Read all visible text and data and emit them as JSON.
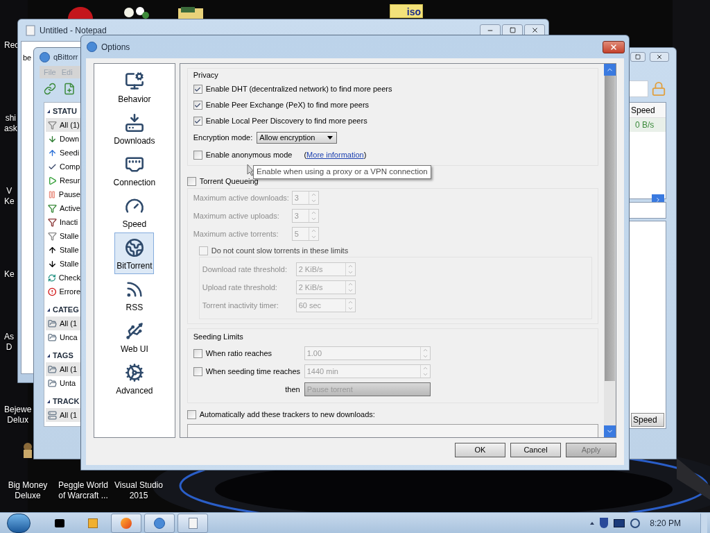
{
  "desktop": {
    "icons": [
      {
        "lines": [
          "Rec"
        ]
      },
      {
        "lines": [
          "shi",
          "ask"
        ]
      },
      {
        "lines": [
          "V",
          "Ke"
        ]
      },
      {
        "lines": [
          "Ke"
        ]
      },
      {
        "lines": [
          "As",
          "D"
        ]
      },
      {
        "lines": [
          "Bejewe",
          "Delux"
        ]
      }
    ],
    "bottom_icons": [
      {
        "lines": [
          "Big Money",
          "Deluxe"
        ]
      },
      {
        "lines": [
          "Peggle World",
          "of Warcraft ..."
        ]
      },
      {
        "lines": [
          "Visual Studio",
          "2015"
        ]
      }
    ],
    "file_icon_label": "iso"
  },
  "notepad": {
    "title": "Untitled - Notepad",
    "text": "be"
  },
  "qbittorrent": {
    "title": "qBittorr",
    "menu": [
      "File",
      "Edi"
    ],
    "sections": [
      {
        "title": "STATU",
        "items": [
          {
            "label": "All (1)",
            "selected": true
          },
          {
            "label": "Down",
            "selected": false
          },
          {
            "label": "Seedi",
            "selected": false
          },
          {
            "label": "Comp",
            "selected": false
          },
          {
            "label": "Resur",
            "selected": false
          },
          {
            "label": "Pause",
            "selected": false
          },
          {
            "label": "Active",
            "selected": false
          },
          {
            "label": "Inacti",
            "selected": false
          },
          {
            "label": "Stalle",
            "selected": false
          },
          {
            "label": "Stalle",
            "selected": false
          },
          {
            "label": "Stalle",
            "selected": false
          },
          {
            "label": "Check",
            "selected": false
          },
          {
            "label": "Errore",
            "selected": false
          }
        ]
      },
      {
        "title": "CATEG",
        "items": [
          {
            "label": "All (1",
            "selected": true
          },
          {
            "label": "Unca",
            "selected": false
          }
        ]
      },
      {
        "title": "TAGS",
        "items": [
          {
            "label": "All (1",
            "selected": true
          },
          {
            "label": "Unta",
            "selected": false
          }
        ]
      },
      {
        "title": "TRACK",
        "items": [
          {
            "label": "All (1",
            "selected": true
          }
        ]
      }
    ],
    "column_header": "Speed",
    "cell": "0 B/s",
    "speed_button": "Speed"
  },
  "options": {
    "title": "Options",
    "pages": [
      {
        "label": "Behavior",
        "selected": false
      },
      {
        "label": "Downloads",
        "selected": false
      },
      {
        "label": "Connection",
        "selected": false
      },
      {
        "label": "Speed",
        "selected": false
      },
      {
        "label": "BitTorrent",
        "selected": true
      },
      {
        "label": "RSS",
        "selected": false
      },
      {
        "label": "Web UI",
        "selected": false
      },
      {
        "label": "Advanced",
        "selected": false
      }
    ],
    "privacy": {
      "title": "Privacy",
      "checks": [
        {
          "label": "Enable DHT (decentralized network) to find more peers",
          "checked": true
        },
        {
          "label": "Enable Peer Exchange (PeX) to find more peers",
          "checked": true
        },
        {
          "label": "Enable Local Peer Discovery to find more peers",
          "checked": true
        }
      ],
      "encryption_label": "Encryption mode:",
      "encryption_value": "Allow encryption",
      "anonymous": {
        "label": "Enable anonymous mode",
        "checked": false
      },
      "link_open": "(",
      "link": "More information",
      "link_close": ")"
    },
    "tooltip": "Enable when using a proxy or a VPN connection",
    "queueing": {
      "label": "Torrent Queueing",
      "checked": false,
      "fields": [
        {
          "label": "Maximum active downloads:",
          "value": "3"
        },
        {
          "label": "Maximum active uploads:",
          "value": "3"
        },
        {
          "label": "Maximum active torrents:",
          "value": "5"
        }
      ],
      "slow": {
        "label": "Do not count slow torrents in these limits",
        "checked": false
      },
      "slow_fields": [
        {
          "label": "Download rate threshold:",
          "value": "2 KiB/s"
        },
        {
          "label": "Upload rate threshold:",
          "value": "2 KiB/s"
        },
        {
          "label": "Torrent inactivity timer:",
          "value": "60 sec"
        }
      ]
    },
    "seeding": {
      "title": "Seeding Limits",
      "limits": [
        {
          "label": "When ratio reaches",
          "checked": false,
          "value": "1.00"
        },
        {
          "label": "When seeding time reaches",
          "checked": false,
          "value": "1440 min"
        }
      ],
      "then_label": "then",
      "then_value": "Pause torrent"
    },
    "trackers": {
      "label": "Automatically add these trackers to new downloads:",
      "checked": false
    },
    "buttons": [
      {
        "label": "OK",
        "disabled": false
      },
      {
        "label": "Cancel",
        "disabled": false
      },
      {
        "label": "Apply",
        "disabled": true
      }
    ]
  },
  "taskbar": {
    "apps": [
      {
        "open": false
      },
      {
        "open": false
      },
      {
        "open": true
      },
      {
        "open": true
      },
      {
        "open": true
      }
    ],
    "clock": "8:20 PM"
  }
}
